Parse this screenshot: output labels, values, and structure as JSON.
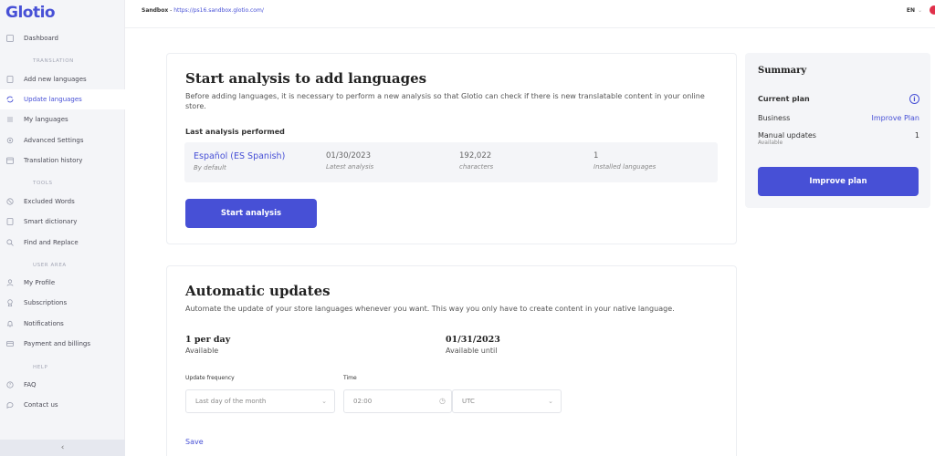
{
  "app": {
    "logo": "Glotio"
  },
  "topbar": {
    "env_label": "Sandbox",
    "env_separator": " - ",
    "env_url": "https://ps16.sandbox.glotio.com/",
    "language": "EN"
  },
  "sidebar": {
    "dashboard": "Dashboard",
    "section_translation": "TRANSLATION",
    "add_new_languages": "Add new languages",
    "update_languages": "Update languages",
    "my_languages": "My languages",
    "advanced_settings": "Advanced Settings",
    "translation_history": "Translation history",
    "section_tools": "TOOLS",
    "excluded_words": "Excluded Words",
    "smart_dictionary": "Smart dictionary",
    "find_and_replace": "Find and Replace",
    "section_user_area": "USER AREA",
    "my_profile": "My Profile",
    "subscriptions": "Subscriptions",
    "notifications": "Notifications",
    "payment_and_billings": "Payment and billings",
    "section_help": "HELP",
    "faq": "FAQ",
    "contact_us": "Contact us",
    "collapse": "‹"
  },
  "analysis": {
    "title": "Start analysis to add languages",
    "description": "Before adding languages, it is necessary to perform a new analysis so that Glotio can check if there is new translatable content in your online store.",
    "last_label": "Last analysis performed",
    "language": "Español (ES Spanish)",
    "language_note": "By default",
    "date": "01/30/2023",
    "date_label": "Latest analysis",
    "characters": "192,022",
    "characters_label": "characters",
    "installed": "1",
    "installed_label": "Installed languages",
    "button": "Start analysis"
  },
  "auto_updates": {
    "title": "Automatic updates",
    "description": "Automate the update of your store languages whenever you want. This way you only have to create content in your native language.",
    "frequency_value": "1 per day",
    "frequency_note": "Available",
    "until_value": "01/31/2023",
    "until_note": "Available until",
    "update_frequency_label": "Update frequency",
    "update_frequency_value": "Last day of the month",
    "time_label": "Time",
    "time_value": "02:00",
    "timezone_value": "UTC",
    "save": "Save"
  },
  "summary": {
    "title": "Summary",
    "current_plan_label": "Current plan",
    "plan_name": "Business",
    "improve_plan_link": "Improve Plan",
    "manual_updates_label": "Manual updates",
    "manual_updates_note": "Available",
    "manual_updates_value": "1",
    "improve_button": "Improve plan"
  },
  "colors": {
    "accent": "#4750d6",
    "sidebar_bg": "#f4f5f8",
    "badge": "#e0304a"
  }
}
